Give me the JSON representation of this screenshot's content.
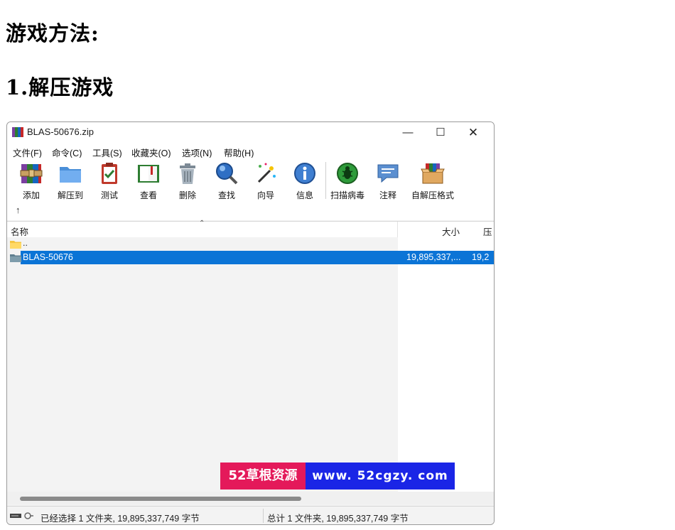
{
  "page": {
    "heading_1": "游戏方法:",
    "heading_2": "1.解压游戏"
  },
  "window": {
    "title": "BLAS-50676.zip",
    "controls": {
      "minimize": "—",
      "maximize": "☐",
      "close": "✕"
    }
  },
  "menu": [
    "文件(F)",
    "命令(C)",
    "工具(S)",
    "收藏夹(O)",
    "选项(N)",
    "帮助(H)"
  ],
  "toolbar": {
    "buttons": [
      {
        "label": "添加",
        "icon": "add-archive-icon"
      },
      {
        "label": "解压到",
        "icon": "extract-folder-icon"
      },
      {
        "label": "测试",
        "icon": "test-clipboard-icon"
      },
      {
        "label": "查看",
        "icon": "view-book-icon"
      },
      {
        "label": "删除",
        "icon": "trash-icon"
      },
      {
        "label": "查找",
        "icon": "find-magnifier-icon"
      },
      {
        "label": "向导",
        "icon": "wizard-wand-icon"
      },
      {
        "label": "信息",
        "icon": "info-icon"
      },
      {
        "label": "扫描病毒",
        "icon": "virus-scan-icon"
      },
      {
        "label": "注释",
        "icon": "comment-icon"
      },
      {
        "label": "自解压格式",
        "icon": "sfx-box-icon"
      }
    ],
    "up_arrow": "↑"
  },
  "list": {
    "columns": {
      "name": "名称",
      "size": "大小",
      "packed": "压"
    },
    "up_row": "..",
    "rows": [
      {
        "name": "BLAS-50676",
        "size": "19,895,337,...",
        "packed": "19,2"
      }
    ]
  },
  "status": {
    "left": "已经选择 1 文件夹, 19,895,337,749 字节",
    "right": "总计 1 文件夹, 19,895,337,749 字节"
  },
  "watermark": {
    "left": "52草根资源",
    "right": "www. 52cgzy. com"
  },
  "colors": {
    "selection": "#0b74d6",
    "watermark_left": "#e4195a",
    "watermark_right": "#1a25e6"
  }
}
